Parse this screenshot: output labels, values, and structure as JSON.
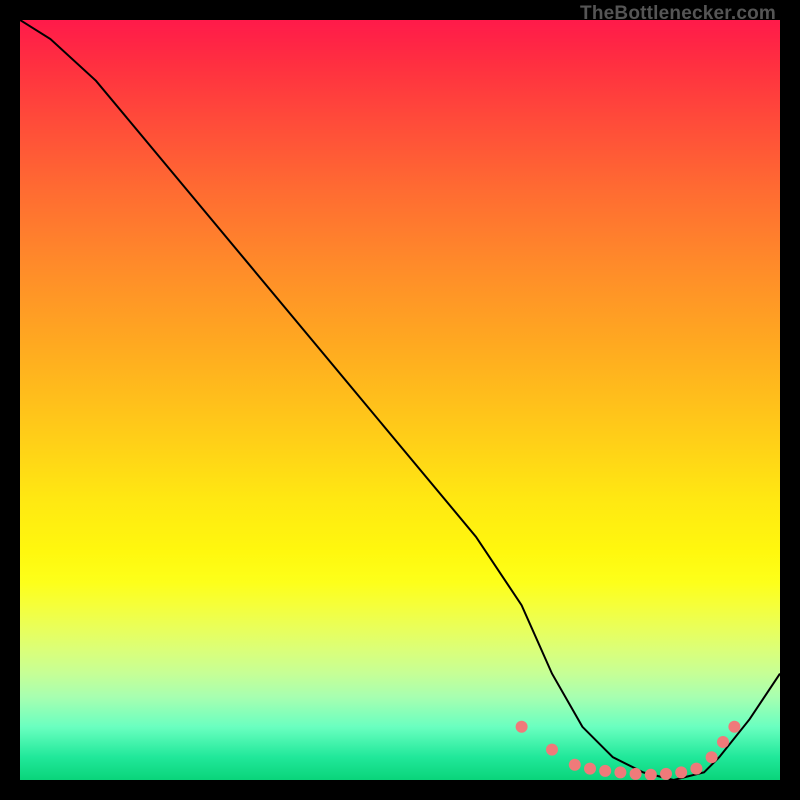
{
  "attribution": "TheBottlenecker.com",
  "chart_data": {
    "type": "line",
    "title": "",
    "xlabel": "",
    "ylabel": "",
    "xlim": [
      0,
      100
    ],
    "ylim": [
      0,
      100
    ],
    "series": [
      {
        "name": "curve",
        "x": [
          0,
          4,
          10,
          20,
          30,
          40,
          50,
          60,
          66,
          70,
          74,
          78,
          82,
          86,
          90,
          92,
          96,
          100
        ],
        "y": [
          100,
          97.5,
          92,
          80,
          68,
          56,
          44,
          32,
          23,
          14,
          7,
          3,
          1,
          0,
          1,
          3,
          8,
          14
        ]
      }
    ],
    "markers": {
      "name": "highlight-dots",
      "x": [
        66,
        70,
        73,
        75,
        77,
        79,
        81,
        83,
        85,
        87,
        89,
        91,
        92.5,
        94
      ],
      "y": [
        7,
        4,
        2,
        1.5,
        1.2,
        1,
        0.8,
        0.7,
        0.8,
        1,
        1.5,
        3,
        5,
        7
      ]
    },
    "background_gradient": {
      "top": "#ff1a4a",
      "mid": "#ffe812",
      "bottom": "#0ad47a"
    }
  }
}
